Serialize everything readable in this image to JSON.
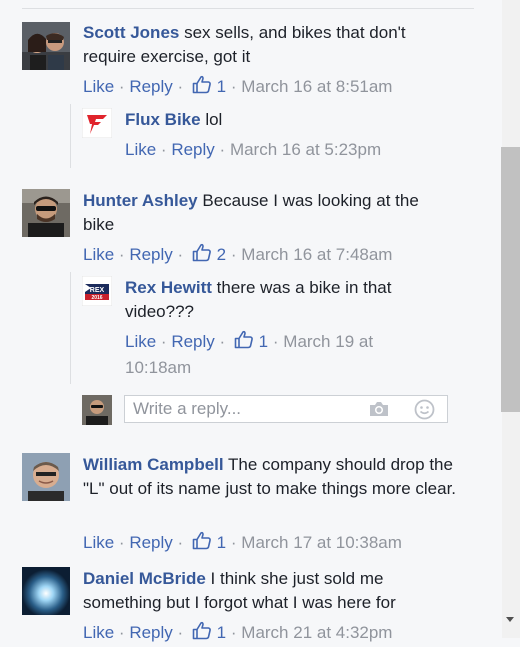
{
  "labels": {
    "like": "Like",
    "reply": "Reply",
    "sep": "·"
  },
  "colors": {
    "author": "#365899",
    "link": "#4267b2",
    "muted": "#90949c",
    "text": "#1d2129"
  },
  "comments": [
    {
      "author": "Scott Jones",
      "text": "sex sells, and bikes that don't require exercise, got it",
      "likes": "1",
      "time": "March 16 at 8:51am",
      "avatar": "couple-photo"
    },
    {
      "author": "Flux Bike",
      "text": "lol",
      "likes": "",
      "time": "March 16 at 5:23pm",
      "avatar": "flux-bike-logo"
    },
    {
      "author": "Hunter Ashley",
      "text": "Because I was looking at the bike",
      "likes": "2",
      "time": "March 16 at 7:48am",
      "avatar": "man-sunglasses-photo"
    },
    {
      "author": "Rex Hewitt",
      "text": "there was a bike in that video???",
      "likes": "1",
      "time": "March 19 at 10:18am",
      "avatar": "campaign-logo"
    },
    {
      "author": "William Campbell",
      "text": "The company should drop the \"L\" out of its name just to make things more clear.",
      "likes": "1",
      "time": "March 17 at 10:38am",
      "avatar": "man-photo"
    },
    {
      "author": "Daniel McBride",
      "text": "I think she just sold me something but I forgot what I was here for",
      "likes": "1",
      "time": "March 21 at 4:32pm",
      "avatar": "blue-light-photo"
    }
  ],
  "reply_box": {
    "placeholder": "Write a reply...",
    "icons": [
      "camera-icon",
      "smiley-icon"
    ]
  },
  "rex_logo_text": [
    "REX",
    "2016"
  ]
}
